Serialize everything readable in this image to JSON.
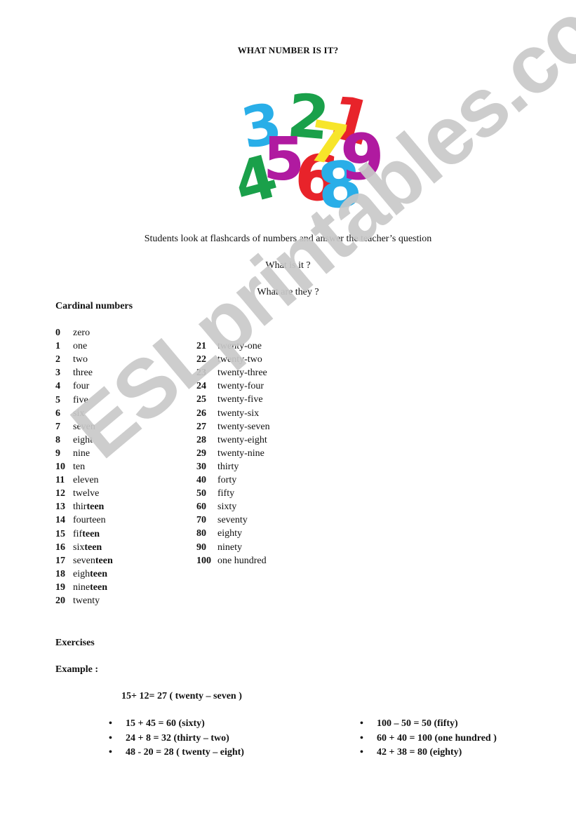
{
  "title": "WHAT NUMBER IS IT?",
  "image": {
    "alt": "Colorful flashcard numbers",
    "digits": [
      {
        "d": "3",
        "color": "#29aee8"
      },
      {
        "d": "2",
        "color": "#1aa04a"
      },
      {
        "d": "1",
        "color": "#e8232a"
      },
      {
        "d": "4",
        "color": "#1aa04a"
      },
      {
        "d": "5",
        "color": "#b01aa0"
      },
      {
        "d": "6",
        "color": "#e8232a"
      },
      {
        "d": "7",
        "color": "#f7e52a"
      },
      {
        "d": "8",
        "color": "#29aee8"
      },
      {
        "d": "9",
        "color": "#b01aa0"
      }
    ]
  },
  "intro": {
    "instruction": "Students look at flashcards of numbers  and answer the teacher’s  question",
    "question1": "What is it ?",
    "question2": "What are they ?"
  },
  "cardinal": {
    "heading": "Cardinal numbers",
    "left": [
      {
        "n": "0",
        "w": "zero"
      },
      {
        "n": "1",
        "w": "one"
      },
      {
        "n": "2",
        "w": "two"
      },
      {
        "n": "3",
        "w": "three"
      },
      {
        "n": "4",
        "w": "four"
      },
      {
        "n": "5",
        "w": "five"
      },
      {
        "n": "6",
        "w": "six"
      },
      {
        "n": "7",
        "w": "seven"
      },
      {
        "n": "8",
        "w": "eight"
      },
      {
        "n": "9",
        "w": "nine"
      },
      {
        "n": "10",
        "w": "ten"
      },
      {
        "n": "11",
        "w": "eleven"
      },
      {
        "n": "12",
        "w": "twelve"
      },
      {
        "n": "13",
        "w": "thir",
        "b": "teen"
      },
      {
        "n": "14",
        "w": "fourteen"
      },
      {
        "n": "15",
        "w": "fif",
        "b": "teen"
      },
      {
        "n": "16",
        "w": "six",
        "b": "teen"
      },
      {
        "n": "17",
        "w": "seven",
        "b": "teen"
      },
      {
        "n": "18",
        "w": "eigh",
        "b": "teen"
      },
      {
        "n": "19",
        "w": "nine",
        "b": "teen"
      },
      {
        "n": "20",
        "w": "twenty"
      }
    ],
    "right": [
      {
        "n": "21",
        "w": "twenty-one"
      },
      {
        "n": "22",
        "w": "twenty-two"
      },
      {
        "n": "23",
        "w": "twenty-three"
      },
      {
        "n": "24",
        "w": "twenty-four"
      },
      {
        "n": "25",
        "w": "twenty-five"
      },
      {
        "n": "26",
        "w": "twenty-six"
      },
      {
        "n": "27",
        "w": "twenty-seven"
      },
      {
        "n": "28",
        "w": "twenty-eight"
      },
      {
        "n": "29",
        "w": "twenty-nine"
      },
      {
        "n": "30",
        "w": "thirty"
      },
      {
        "n": "40",
        "w": "forty"
      },
      {
        "n": "50",
        "w": "fifty"
      },
      {
        "n": "60",
        "w": "sixty"
      },
      {
        "n": "70",
        "w": "seventy"
      },
      {
        "n": "80",
        "w": "eighty"
      },
      {
        "n": "90",
        "w": "ninety"
      },
      {
        "n": "100",
        "w": "one hundred"
      }
    ]
  },
  "exercises": {
    "heading": "Exercises",
    "example_label": "Example :",
    "example": "15+ 12= 27 (  twenty – seven )",
    "left_items": [
      "15 + 45 = 60 (sixty)",
      "24 + 8  = 32 (thirty – two)",
      "48 - 20 = 28 ( twenty – eight)"
    ],
    "right_items": [
      "100 – 50 = 50 (fifty)",
      "60 + 40 = 100 (one hundred )",
      "42 + 38 = 80 (eighty)"
    ]
  },
  "watermark": "ESLprintables.com"
}
